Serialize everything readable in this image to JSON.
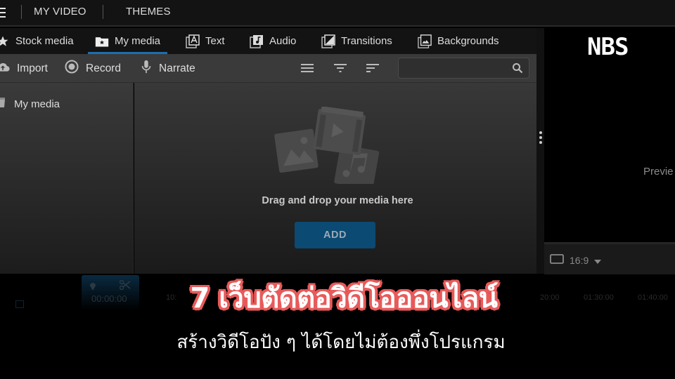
{
  "topbar": {
    "menu_icon": "hamburger-icon",
    "items": [
      "MY VIDEO",
      "THEMES"
    ]
  },
  "tabs": [
    {
      "label": "Stock media",
      "icon": "star-icon",
      "active": false
    },
    {
      "label": "My media",
      "icon": "folder-star-icon",
      "active": true
    },
    {
      "label": "Text",
      "icon": "text-layers-icon",
      "active": false
    },
    {
      "label": "Audio",
      "icon": "music-layers-icon",
      "active": false
    },
    {
      "label": "Transitions",
      "icon": "transition-layers-icon",
      "active": false
    },
    {
      "label": "Backgrounds",
      "icon": "image-layers-icon",
      "active": false
    }
  ],
  "toolbar": {
    "import_label": "Import",
    "record_label": "Record",
    "narrate_label": "Narrate",
    "view_icons": [
      "list-view-icon",
      "filter-icon",
      "sort-icon"
    ],
    "search_placeholder": "",
    "search_value": ""
  },
  "sidebar": {
    "items": [
      {
        "label": "My media",
        "icon": "folder-icon"
      }
    ]
  },
  "dropzone": {
    "message": "Drag and drop your media here",
    "add_label": "ADD"
  },
  "preview": {
    "logo": "NBS",
    "placeholder": "Previe",
    "aspect_ratio": "16:9"
  },
  "timeline": {
    "current_time": "00:00:00",
    "ticks": [
      "10:",
      "20:00",
      "01:30:00",
      "01:40:00"
    ]
  },
  "overlay": {
    "headline": "7 เว็บตัดต่อวิดีโอออนไลน์",
    "subheadline": "สร้างวิดีโอปัง ๆ ได้โดยไม่ต้องพึ่งโปรแกรม",
    "accent_color": "#e85a5a"
  },
  "colors": {
    "tab_underline": "#1b6fb0",
    "add_button": "#0b4a72"
  }
}
